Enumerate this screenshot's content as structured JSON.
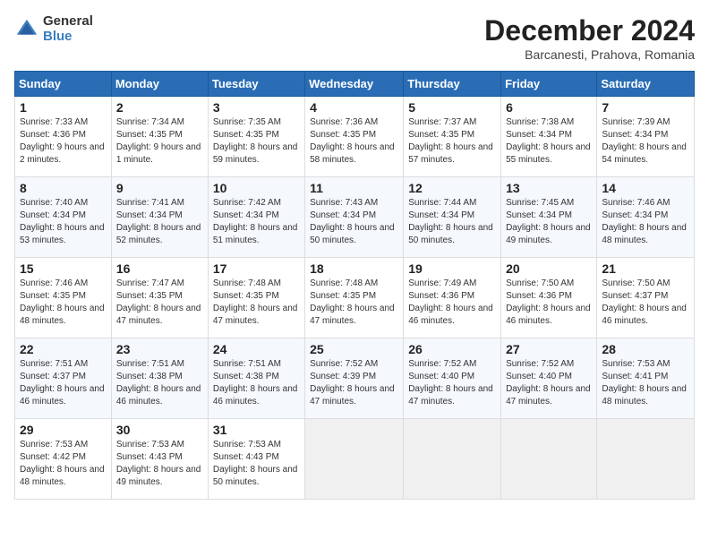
{
  "logo": {
    "general": "General",
    "blue": "Blue"
  },
  "header": {
    "month": "December 2024",
    "location": "Barcanesti, Prahova, Romania"
  },
  "weekdays": [
    "Sunday",
    "Monday",
    "Tuesday",
    "Wednesday",
    "Thursday",
    "Friday",
    "Saturday"
  ],
  "weeks": [
    [
      {
        "day": "1",
        "sunrise": "Sunrise: 7:33 AM",
        "sunset": "Sunset: 4:36 PM",
        "daylight": "Daylight: 9 hours and 2 minutes."
      },
      {
        "day": "2",
        "sunrise": "Sunrise: 7:34 AM",
        "sunset": "Sunset: 4:35 PM",
        "daylight": "Daylight: 9 hours and 1 minute."
      },
      {
        "day": "3",
        "sunrise": "Sunrise: 7:35 AM",
        "sunset": "Sunset: 4:35 PM",
        "daylight": "Daylight: 8 hours and 59 minutes."
      },
      {
        "day": "4",
        "sunrise": "Sunrise: 7:36 AM",
        "sunset": "Sunset: 4:35 PM",
        "daylight": "Daylight: 8 hours and 58 minutes."
      },
      {
        "day": "5",
        "sunrise": "Sunrise: 7:37 AM",
        "sunset": "Sunset: 4:35 PM",
        "daylight": "Daylight: 8 hours and 57 minutes."
      },
      {
        "day": "6",
        "sunrise": "Sunrise: 7:38 AM",
        "sunset": "Sunset: 4:34 PM",
        "daylight": "Daylight: 8 hours and 55 minutes."
      },
      {
        "day": "7",
        "sunrise": "Sunrise: 7:39 AM",
        "sunset": "Sunset: 4:34 PM",
        "daylight": "Daylight: 8 hours and 54 minutes."
      }
    ],
    [
      {
        "day": "8",
        "sunrise": "Sunrise: 7:40 AM",
        "sunset": "Sunset: 4:34 PM",
        "daylight": "Daylight: 8 hours and 53 minutes."
      },
      {
        "day": "9",
        "sunrise": "Sunrise: 7:41 AM",
        "sunset": "Sunset: 4:34 PM",
        "daylight": "Daylight: 8 hours and 52 minutes."
      },
      {
        "day": "10",
        "sunrise": "Sunrise: 7:42 AM",
        "sunset": "Sunset: 4:34 PM",
        "daylight": "Daylight: 8 hours and 51 minutes."
      },
      {
        "day": "11",
        "sunrise": "Sunrise: 7:43 AM",
        "sunset": "Sunset: 4:34 PM",
        "daylight": "Daylight: 8 hours and 50 minutes."
      },
      {
        "day": "12",
        "sunrise": "Sunrise: 7:44 AM",
        "sunset": "Sunset: 4:34 PM",
        "daylight": "Daylight: 8 hours and 50 minutes."
      },
      {
        "day": "13",
        "sunrise": "Sunrise: 7:45 AM",
        "sunset": "Sunset: 4:34 PM",
        "daylight": "Daylight: 8 hours and 49 minutes."
      },
      {
        "day": "14",
        "sunrise": "Sunrise: 7:46 AM",
        "sunset": "Sunset: 4:34 PM",
        "daylight": "Daylight: 8 hours and 48 minutes."
      }
    ],
    [
      {
        "day": "15",
        "sunrise": "Sunrise: 7:46 AM",
        "sunset": "Sunset: 4:35 PM",
        "daylight": "Daylight: 8 hours and 48 minutes."
      },
      {
        "day": "16",
        "sunrise": "Sunrise: 7:47 AM",
        "sunset": "Sunset: 4:35 PM",
        "daylight": "Daylight: 8 hours and 47 minutes."
      },
      {
        "day": "17",
        "sunrise": "Sunrise: 7:48 AM",
        "sunset": "Sunset: 4:35 PM",
        "daylight": "Daylight: 8 hours and 47 minutes."
      },
      {
        "day": "18",
        "sunrise": "Sunrise: 7:48 AM",
        "sunset": "Sunset: 4:35 PM",
        "daylight": "Daylight: 8 hours and 47 minutes."
      },
      {
        "day": "19",
        "sunrise": "Sunrise: 7:49 AM",
        "sunset": "Sunset: 4:36 PM",
        "daylight": "Daylight: 8 hours and 46 minutes."
      },
      {
        "day": "20",
        "sunrise": "Sunrise: 7:50 AM",
        "sunset": "Sunset: 4:36 PM",
        "daylight": "Daylight: 8 hours and 46 minutes."
      },
      {
        "day": "21",
        "sunrise": "Sunrise: 7:50 AM",
        "sunset": "Sunset: 4:37 PM",
        "daylight": "Daylight: 8 hours and 46 minutes."
      }
    ],
    [
      {
        "day": "22",
        "sunrise": "Sunrise: 7:51 AM",
        "sunset": "Sunset: 4:37 PM",
        "daylight": "Daylight: 8 hours and 46 minutes."
      },
      {
        "day": "23",
        "sunrise": "Sunrise: 7:51 AM",
        "sunset": "Sunset: 4:38 PM",
        "daylight": "Daylight: 8 hours and 46 minutes."
      },
      {
        "day": "24",
        "sunrise": "Sunrise: 7:51 AM",
        "sunset": "Sunset: 4:38 PM",
        "daylight": "Daylight: 8 hours and 46 minutes."
      },
      {
        "day": "25",
        "sunrise": "Sunrise: 7:52 AM",
        "sunset": "Sunset: 4:39 PM",
        "daylight": "Daylight: 8 hours and 47 minutes."
      },
      {
        "day": "26",
        "sunrise": "Sunrise: 7:52 AM",
        "sunset": "Sunset: 4:40 PM",
        "daylight": "Daylight: 8 hours and 47 minutes."
      },
      {
        "day": "27",
        "sunrise": "Sunrise: 7:52 AM",
        "sunset": "Sunset: 4:40 PM",
        "daylight": "Daylight: 8 hours and 47 minutes."
      },
      {
        "day": "28",
        "sunrise": "Sunrise: 7:53 AM",
        "sunset": "Sunset: 4:41 PM",
        "daylight": "Daylight: 8 hours and 48 minutes."
      }
    ],
    [
      {
        "day": "29",
        "sunrise": "Sunrise: 7:53 AM",
        "sunset": "Sunset: 4:42 PM",
        "daylight": "Daylight: 8 hours and 48 minutes."
      },
      {
        "day": "30",
        "sunrise": "Sunrise: 7:53 AM",
        "sunset": "Sunset: 4:43 PM",
        "daylight": "Daylight: 8 hours and 49 minutes."
      },
      {
        "day": "31",
        "sunrise": "Sunrise: 7:53 AM",
        "sunset": "Sunset: 4:43 PM",
        "daylight": "Daylight: 8 hours and 50 minutes."
      },
      null,
      null,
      null,
      null
    ]
  ]
}
